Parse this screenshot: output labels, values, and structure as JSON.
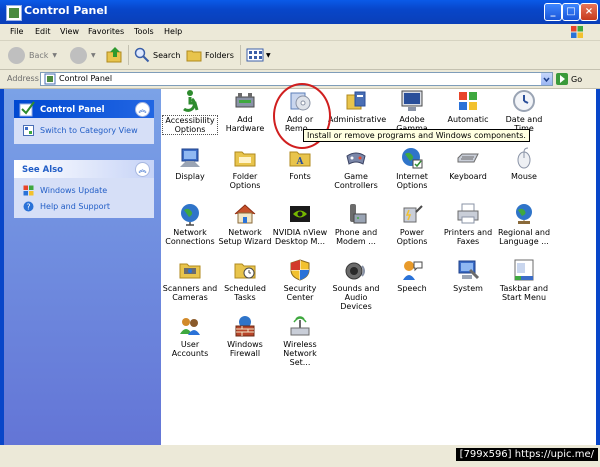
{
  "window": {
    "title": "Control Panel"
  },
  "menu": [
    "File",
    "Edit",
    "View",
    "Favorites",
    "Tools",
    "Help"
  ],
  "toolbar": {
    "back": "Back",
    "search": "Search",
    "folders": "Folders"
  },
  "address": {
    "label": "Address",
    "value": "Control Panel",
    "go": "Go"
  },
  "left_panel": {
    "control_panel": {
      "title": "Control Panel",
      "link": "Switch to Category View"
    },
    "see_also": {
      "title": "See Also",
      "links": [
        "Windows Update",
        "Help and Support"
      ]
    }
  },
  "items": [
    {
      "id": "accessibility",
      "label": "Accessibility Options",
      "icon": "accessibility-icon",
      "color": "#2e8b2e"
    },
    {
      "id": "add-hardware",
      "label": "Add Hardware",
      "icon": "hardware-icon",
      "color": "#6b6b6b"
    },
    {
      "id": "add-remove",
      "label": "Add or Remo...",
      "icon": "cd-box-icon",
      "color": "#5c7fb8"
    },
    {
      "id": "admin-tools",
      "label": "Administrative",
      "icon": "admin-tools-icon",
      "color": "#4a6fb5"
    },
    {
      "id": "adobe-gamma",
      "label": "Adobe Gamma",
      "icon": "monitor-icon",
      "color": "#2a4f9a"
    },
    {
      "id": "automatic",
      "label": "Automatic",
      "icon": "windows-flag-icon",
      "color": "#1e90ff"
    },
    {
      "id": "date-time",
      "label": "Date and Time",
      "icon": "clock-icon",
      "color": "#9aa4b4"
    },
    {
      "id": "display",
      "label": "Display",
      "icon": "display-icon",
      "color": "#3b6cc7"
    },
    {
      "id": "folder-options",
      "label": "Folder Options",
      "icon": "folder-icon",
      "color": "#e8c44c"
    },
    {
      "id": "fonts",
      "label": "Fonts",
      "icon": "fonts-icon",
      "color": "#e8c44c"
    },
    {
      "id": "game-controllers",
      "label": "Game Controllers",
      "icon": "gamepad-icon",
      "color": "#7a86a8"
    },
    {
      "id": "internet-options",
      "label": "Internet Options",
      "icon": "globe-icon",
      "color": "#2f74c9"
    },
    {
      "id": "keyboard",
      "label": "Keyboard",
      "icon": "keyboard-icon",
      "color": "#8a93a6"
    },
    {
      "id": "mouse",
      "label": "Mouse",
      "icon": "mouse-icon",
      "color": "#c9ced8"
    },
    {
      "id": "network-connections",
      "label": "Network Connections",
      "icon": "network-icon",
      "color": "#2f74c9"
    },
    {
      "id": "network-setup",
      "label": "Network Setup Wizard",
      "icon": "house-icon",
      "color": "#c8502a"
    },
    {
      "id": "nvidia",
      "label": "NVIDIA nView Desktop M...",
      "icon": "nvidia-icon",
      "color": "#76b900"
    },
    {
      "id": "phone-modem",
      "label": "Phone and Modem ...",
      "icon": "phone-icon",
      "color": "#6b6b6b"
    },
    {
      "id": "power-options",
      "label": "Power Options",
      "icon": "power-icon",
      "color": "#8a93a6"
    },
    {
      "id": "printers-faxes",
      "label": "Printers and Faxes",
      "icon": "printer-icon",
      "color": "#8a93a6"
    },
    {
      "id": "regional",
      "label": "Regional and Language ...",
      "icon": "globe-clock-icon",
      "color": "#2f74c9"
    },
    {
      "id": "scanners",
      "label": "Scanners and Cameras",
      "icon": "scanner-icon",
      "color": "#e8c44c"
    },
    {
      "id": "scheduled-tasks",
      "label": "Scheduled Tasks",
      "icon": "task-folder-icon",
      "color": "#e8c44c"
    },
    {
      "id": "security-center",
      "label": "Security Center",
      "icon": "shield-icon",
      "color": "#d23b2b"
    },
    {
      "id": "sounds",
      "label": "Sounds and Audio Devices",
      "icon": "speaker-icon",
      "color": "#6b6b6b"
    },
    {
      "id": "speech",
      "label": "Speech",
      "icon": "speech-icon",
      "color": "#e89a2a"
    },
    {
      "id": "system",
      "label": "System",
      "icon": "system-icon",
      "color": "#3b6cc7"
    },
    {
      "id": "taskbar",
      "label": "Taskbar and Start Menu",
      "icon": "taskbar-icon",
      "color": "#3b6cc7"
    },
    {
      "id": "user-accounts",
      "label": "User Accounts",
      "icon": "users-icon",
      "color": "#d28a2a"
    },
    {
      "id": "windows-firewall",
      "label": "Windows Firewall",
      "icon": "firewall-icon",
      "color": "#b8452a"
    },
    {
      "id": "wireless",
      "label": "Wireless Network Set...",
      "icon": "wireless-icon",
      "color": "#8a93a6"
    }
  ],
  "tooltip": "Install or remove programs and Windows components.",
  "watermark": "[799x596] https://upic.me/"
}
